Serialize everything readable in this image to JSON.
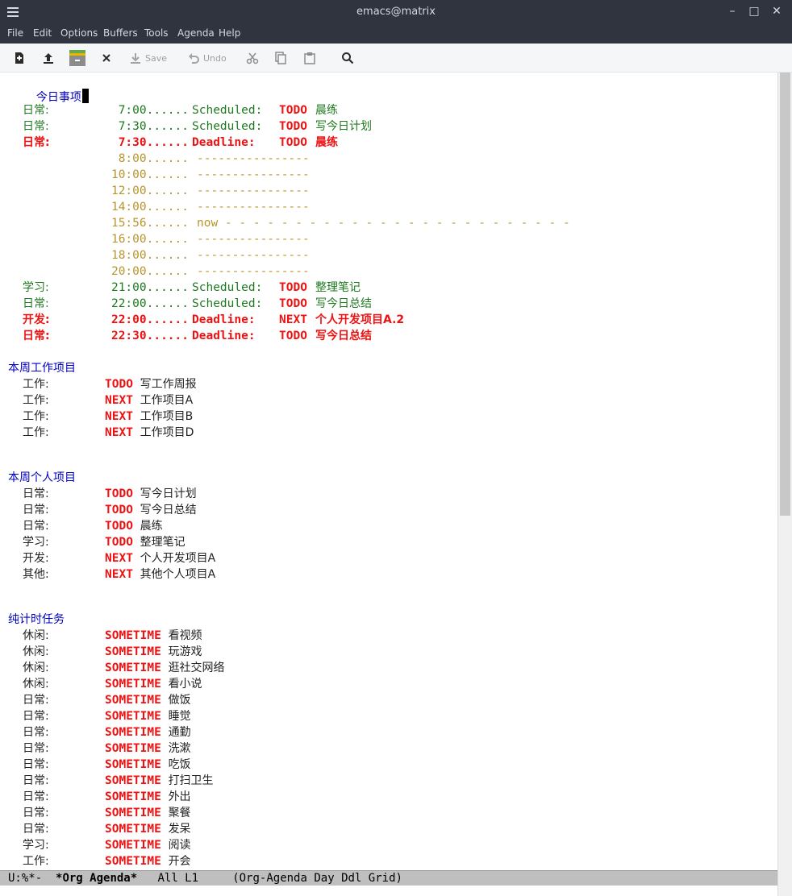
{
  "window": {
    "title": "emacs@matrix"
  },
  "menu": [
    "File",
    "Edit",
    "Options",
    "Buffers",
    "Tools",
    "Agenda",
    "Help"
  ],
  "toolbar": {
    "save_label": "Save",
    "undo_label": "Undo"
  },
  "agenda": {
    "heading": "今日事项",
    "items": [
      {
        "cat": "日常:",
        "time": "7:00......",
        "kind": "Scheduled:",
        "kw": "TODO",
        "text": "晨练",
        "style": "green"
      },
      {
        "cat": "日常:",
        "time": "7:30......",
        "kind": "Scheduled:",
        "kw": "TODO",
        "text": "写今日计划",
        "style": "green"
      },
      {
        "cat": "日常:",
        "time": "7:30......",
        "kind": "Deadline:",
        "kw": "TODO",
        "text": "晨练",
        "style": "red"
      },
      {
        "time": "8:00......",
        "grid": "----------------",
        "style": "gold"
      },
      {
        "time": "10:00......",
        "grid": "----------------",
        "style": "gold"
      },
      {
        "time": "12:00......",
        "grid": "----------------",
        "style": "gold"
      },
      {
        "time": "14:00......",
        "grid": "----------------",
        "style": "gold"
      },
      {
        "time": "15:56......",
        "grid": "now - - - - - - - - - - - - - - - - - - - - - - - - -",
        "style": "gold"
      },
      {
        "time": "16:00......",
        "grid": "----------------",
        "style": "gold"
      },
      {
        "time": "18:00......",
        "grid": "----------------",
        "style": "gold"
      },
      {
        "time": "20:00......",
        "grid": "----------------",
        "style": "gold"
      },
      {
        "cat": "学习:",
        "time": "21:00......",
        "kind": "Scheduled:",
        "kw": "TODO",
        "text": "整理笔记",
        "style": "green"
      },
      {
        "cat": "日常:",
        "time": "22:00......",
        "kind": "Scheduled:",
        "kw": "TODO",
        "text": "写今日总结",
        "style": "green"
      },
      {
        "cat": "开发:",
        "time": "22:00......",
        "kind": "Deadline:",
        "kw": "NEXT",
        "text": "个人开发项目A.2",
        "style": "red"
      },
      {
        "cat": "日常:",
        "time": "22:30......",
        "kind": "Deadline:",
        "kw": "TODO",
        "text": "写今日总结",
        "style": "red"
      }
    ]
  },
  "sections": [
    {
      "heading": "本周工作项目",
      "rows": [
        {
          "cat": "工作:",
          "kw": "TODO",
          "text": "写工作周报"
        },
        {
          "cat": "工作:",
          "kw": "NEXT",
          "text": "工作项目A"
        },
        {
          "cat": "工作:",
          "kw": "NEXT",
          "text": "工作项目B"
        },
        {
          "cat": "工作:",
          "kw": "NEXT",
          "text": "工作项目D"
        }
      ]
    },
    {
      "heading": "本周个人项目",
      "rows": [
        {
          "cat": "日常:",
          "kw": "TODO",
          "text": "写今日计划"
        },
        {
          "cat": "日常:",
          "kw": "TODO",
          "text": "写今日总结"
        },
        {
          "cat": "日常:",
          "kw": "TODO",
          "text": "晨练"
        },
        {
          "cat": "学习:",
          "kw": "TODO",
          "text": "整理笔记"
        },
        {
          "cat": "开发:",
          "kw": "NEXT",
          "text": "个人开发项目A"
        },
        {
          "cat": "其他:",
          "kw": "NEXT",
          "text": "其他个人项目A"
        }
      ]
    },
    {
      "heading": "纯计时任务",
      "rows": [
        {
          "cat": "休闲:",
          "kw": "SOMETIME",
          "text": "看视频"
        },
        {
          "cat": "休闲:",
          "kw": "SOMETIME",
          "text": "玩游戏"
        },
        {
          "cat": "休闲:",
          "kw": "SOMETIME",
          "text": "逛社交网络"
        },
        {
          "cat": "休闲:",
          "kw": "SOMETIME",
          "text": "看小说"
        },
        {
          "cat": "日常:",
          "kw": "SOMETIME",
          "text": "做饭"
        },
        {
          "cat": "日常:",
          "kw": "SOMETIME",
          "text": "睡觉"
        },
        {
          "cat": "日常:",
          "kw": "SOMETIME",
          "text": "通勤"
        },
        {
          "cat": "日常:",
          "kw": "SOMETIME",
          "text": "洗漱"
        },
        {
          "cat": "日常:",
          "kw": "SOMETIME",
          "text": "吃饭"
        },
        {
          "cat": "日常:",
          "kw": "SOMETIME",
          "text": "打扫卫生"
        },
        {
          "cat": "日常:",
          "kw": "SOMETIME",
          "text": "外出"
        },
        {
          "cat": "日常:",
          "kw": "SOMETIME",
          "text": "聚餐"
        },
        {
          "cat": "日常:",
          "kw": "SOMETIME",
          "text": "发呆"
        },
        {
          "cat": "学习:",
          "kw": "SOMETIME",
          "text": "阅读"
        },
        {
          "cat": "工作:",
          "kw": "SOMETIME",
          "text": "开会"
        }
      ]
    }
  ],
  "modeline": {
    "status": "U:%*-",
    "buffer": "*Org Agenda*",
    "position": "All L1",
    "modes": "(Org-Agenda Day Ddl Grid)"
  },
  "colors": {
    "heading": "#0000c0",
    "scheduled": "#1e7a1e",
    "deadline": "#ee1111",
    "grid": "#b8962e",
    "keyword": "#ee1111"
  }
}
